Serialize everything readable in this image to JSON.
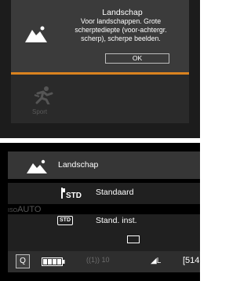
{
  "screen1": {
    "info": {
      "title": "Landschap",
      "desc_lines": [
        "Voor landschappen. Grote",
        "scherptediepte (voor-achtergr.",
        "scherp), scherpe beelden."
      ],
      "ok_label": "OK"
    },
    "mode": {
      "label": "Sport",
      "icon": "sport-runner-icon"
    },
    "colors": {
      "accent": "#d9821f"
    }
  },
  "screen2": {
    "header": {
      "title": "Landschap",
      "icon": "landscape-mountain-icon"
    },
    "picture_style": {
      "icon_label": "STD",
      "value": "Standaard"
    },
    "white_balance": {
      "badge": "STD",
      "value": "Stand. inst."
    },
    "auto_label": {
      "prefix": "ISO",
      "value": "AUTO"
    },
    "status": {
      "q_label": "Q",
      "wifi_label": "((1)) 10",
      "quality_label": "◢L",
      "shots_label": "[514"
    }
  }
}
